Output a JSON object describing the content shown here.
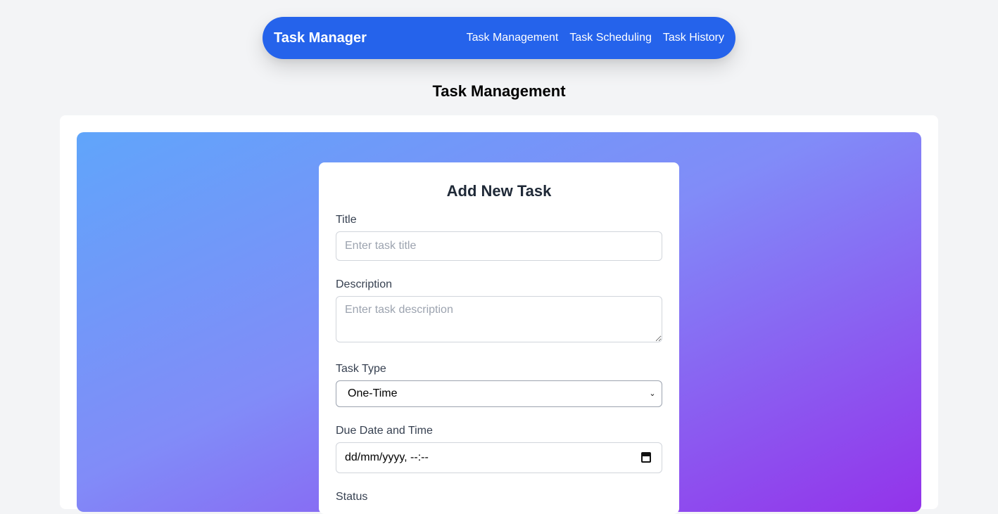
{
  "nav": {
    "brand": "Task Manager",
    "links": [
      {
        "label": "Task Management"
      },
      {
        "label": "Task Scheduling"
      },
      {
        "label": "Task History"
      }
    ]
  },
  "page": {
    "title": "Task Management"
  },
  "form": {
    "heading": "Add New Task",
    "title_label": "Title",
    "title_placeholder": "Enter task title",
    "description_label": "Description",
    "description_placeholder": "Enter task description",
    "type_label": "Task Type",
    "type_value": "One-Time",
    "due_label": "Due Date and Time",
    "due_value": "dd/mm/yyyy, --:--",
    "status_label": "Status"
  },
  "colors": {
    "nav_bg": "#2563eb",
    "gradient_start": "#60a5fa",
    "gradient_end": "#9333ea"
  }
}
